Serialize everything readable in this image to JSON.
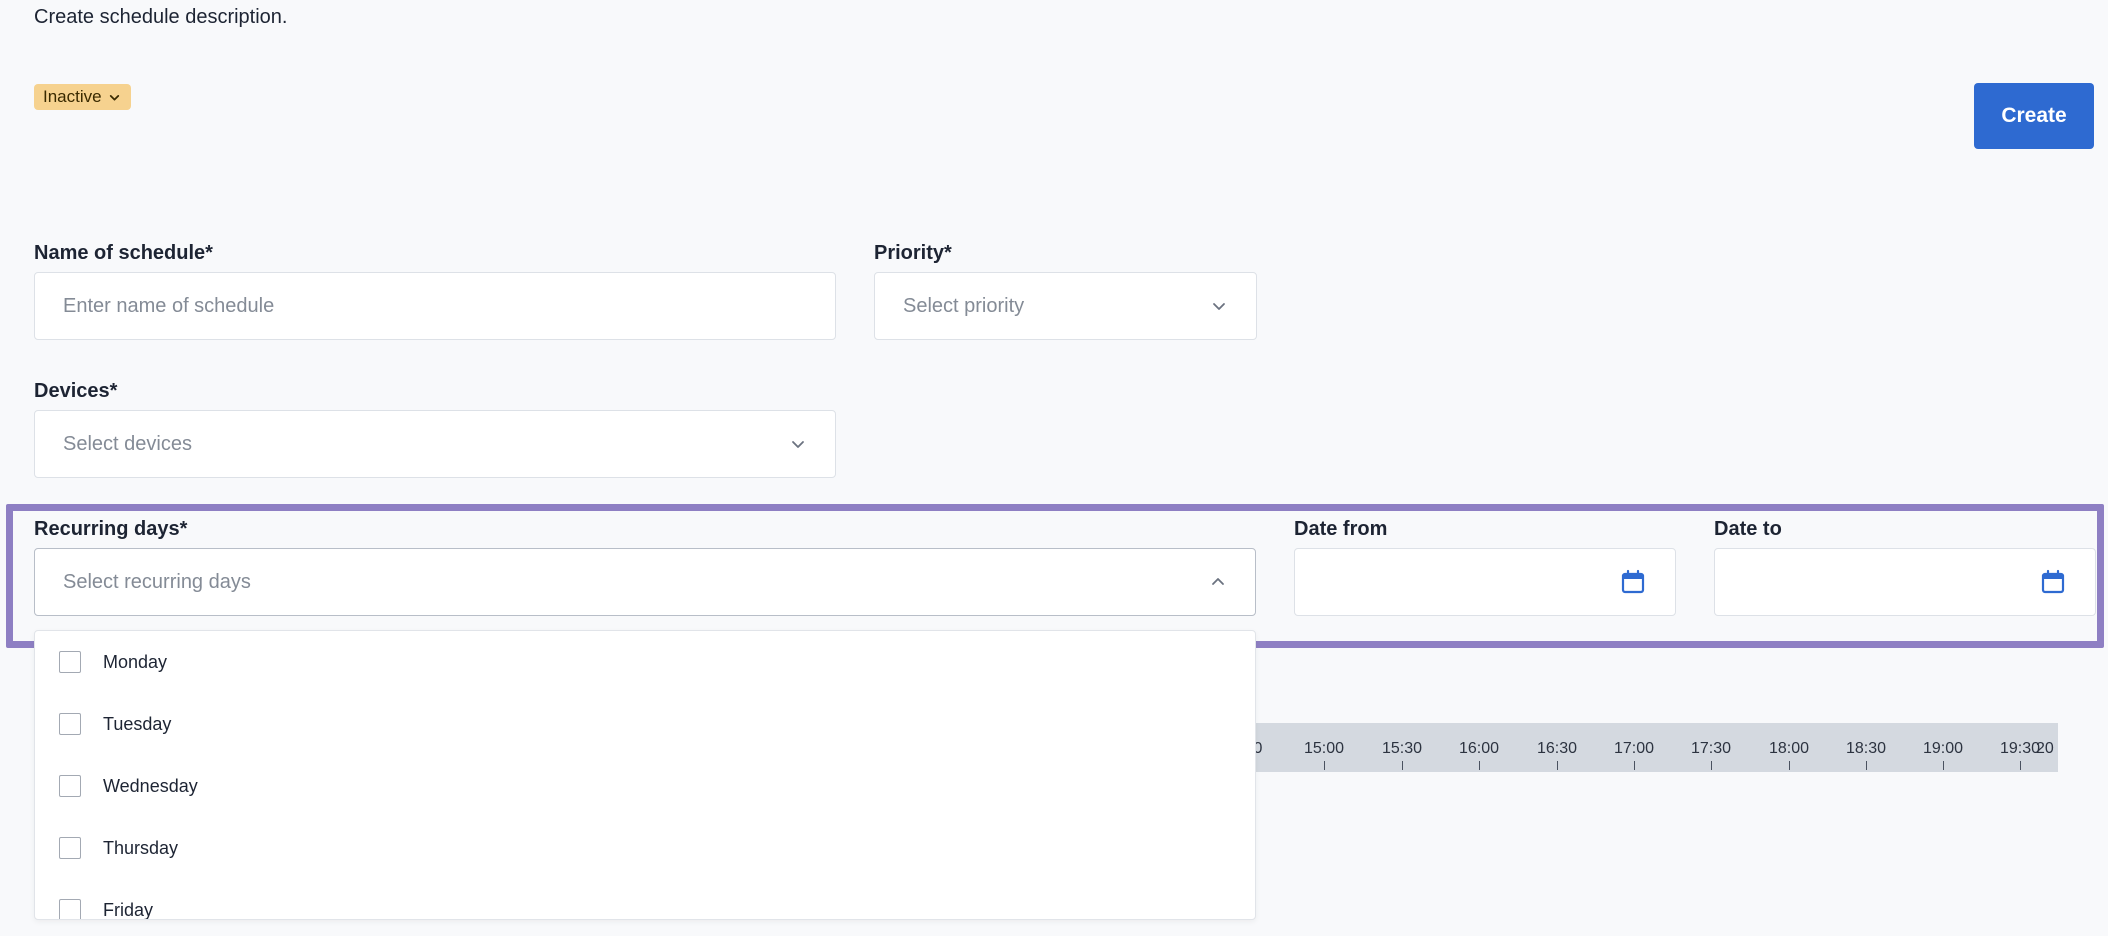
{
  "header": {
    "description": "Create schedule description.",
    "status_label": "Inactive",
    "create_label": "Create"
  },
  "form": {
    "name": {
      "label": "Name of schedule*",
      "placeholder": "Enter name of schedule",
      "value": ""
    },
    "priority": {
      "label": "Priority*",
      "placeholder": "Select priority"
    },
    "devices": {
      "label": "Devices*",
      "placeholder": "Select devices"
    },
    "recurring_days": {
      "label": "Recurring days*",
      "placeholder": "Select recurring days",
      "options": [
        "Monday",
        "Tuesday",
        "Wednesday",
        "Thursday",
        "Friday"
      ]
    },
    "date_from": {
      "label": "Date from",
      "value": ""
    },
    "date_to": {
      "label": "Date to",
      "value": ""
    }
  },
  "timeline": {
    "ticks": [
      "0",
      "15:00",
      "15:30",
      "16:00",
      "16:30",
      "17:00",
      "17:30",
      "18:00",
      "18:30",
      "19:00",
      "19:30",
      "20"
    ]
  },
  "colors": {
    "accent": "#2e6ad1",
    "badge": "#f6d28f",
    "highlight": "#8e7fc3",
    "timeline_bg": "#d4d9e0"
  },
  "icons": {
    "status_chevron": "chevron-down-icon",
    "select_chevron": "chevron-down-icon",
    "recurring_chevron": "chevron-up-icon",
    "date_picker": "calendar-icon"
  }
}
